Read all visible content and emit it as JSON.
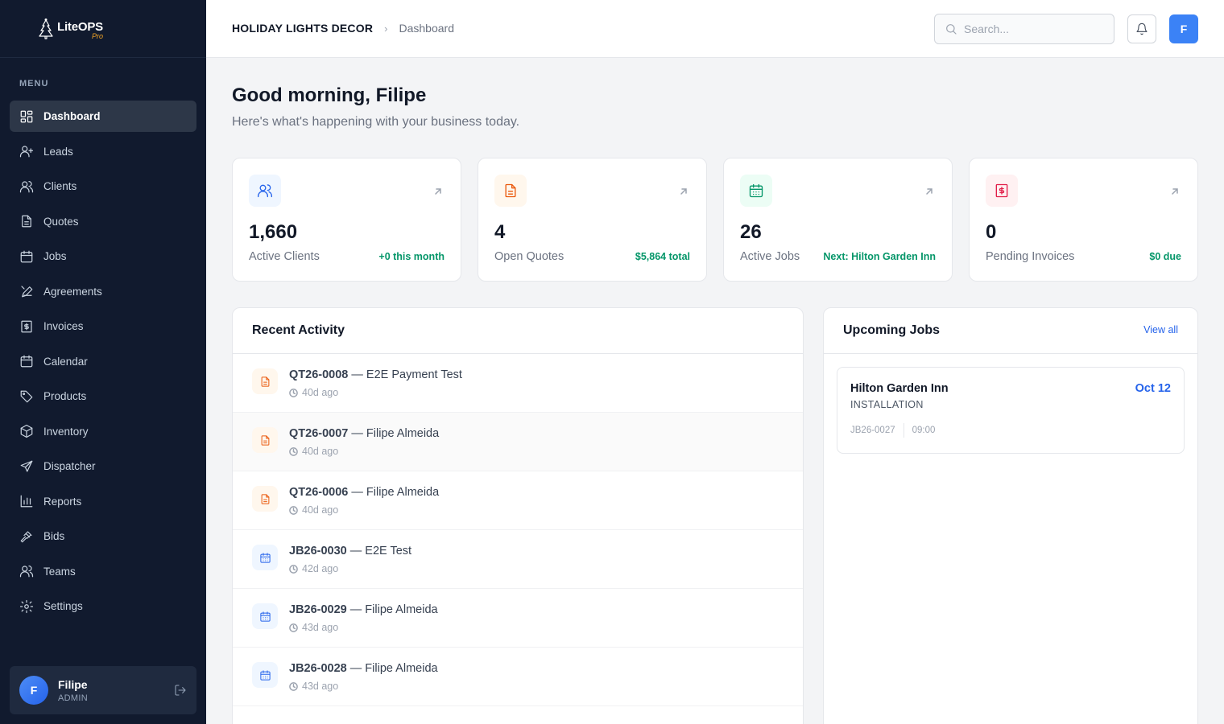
{
  "app": {
    "name": "LiteOPS",
    "edition": "Pro"
  },
  "sidebar": {
    "menu_label": "MENU",
    "items": [
      {
        "label": "Dashboard",
        "icon": "dashboard-icon"
      },
      {
        "label": "Leads",
        "icon": "user-plus-icon"
      },
      {
        "label": "Clients",
        "icon": "users-icon"
      },
      {
        "label": "Quotes",
        "icon": "document-icon"
      },
      {
        "label": "Jobs",
        "icon": "calendar-icon"
      },
      {
        "label": "Agreements",
        "icon": "signature-icon"
      },
      {
        "label": "Invoices",
        "icon": "dollar-document-icon"
      },
      {
        "label": "Calendar",
        "icon": "calendar-icon"
      },
      {
        "label": "Products",
        "icon": "tag-icon"
      },
      {
        "label": "Inventory",
        "icon": "box-icon"
      },
      {
        "label": "Dispatcher",
        "icon": "send-icon"
      },
      {
        "label": "Reports",
        "icon": "bar-chart-icon"
      },
      {
        "label": "Bids",
        "icon": "gavel-icon"
      },
      {
        "label": "Teams",
        "icon": "users-icon"
      },
      {
        "label": "Settings",
        "icon": "gear-icon"
      }
    ],
    "user": {
      "initial": "F",
      "name": "Filipe",
      "role": "ADMIN"
    }
  },
  "header": {
    "company": "HOLIDAY LIGHTS DECOR",
    "page": "Dashboard",
    "search_placeholder": "Search...",
    "avatar_initial": "F"
  },
  "main": {
    "greeting": "Good morning, Filipe",
    "subgreeting": "Here's what's happening with your business today.",
    "stats": [
      {
        "value": "1,660",
        "label": "Active Clients",
        "note": "+0 this month",
        "icon": "users-icon",
        "color": "#2563eb",
        "bg": "#eff6ff"
      },
      {
        "value": "4",
        "label": "Open Quotes",
        "note": "$5,864 total",
        "icon": "document-icon",
        "color": "#ea580c",
        "bg": "#fff7ed"
      },
      {
        "value": "26",
        "label": "Active Jobs",
        "note": "Next: Hilton Garden Inn",
        "icon": "calendar-icon",
        "color": "#059669",
        "bg": "#ecfdf5"
      },
      {
        "value": "0",
        "label": "Pending Invoices",
        "note": "$0 due",
        "icon": "dollar-document-icon",
        "color": "#e11d48",
        "bg": "#fff1f2"
      }
    ],
    "recent_activity": {
      "title": "Recent Activity",
      "items": [
        {
          "code": "QT26-0008",
          "text": " — E2E Payment Test",
          "time": "40d ago",
          "kind": "quote"
        },
        {
          "code": "QT26-0007",
          "text": " — Filipe Almeida",
          "time": "40d ago",
          "kind": "quote"
        },
        {
          "code": "QT26-0006",
          "text": " — Filipe Almeida",
          "time": "40d ago",
          "kind": "quote"
        },
        {
          "code": "JB26-0030",
          "text": " — E2E Test",
          "time": "42d ago",
          "kind": "job"
        },
        {
          "code": "JB26-0029",
          "text": " — Filipe Almeida",
          "time": "43d ago",
          "kind": "job"
        },
        {
          "code": "JB26-0028",
          "text": " — Filipe Almeida",
          "time": "43d ago",
          "kind": "job"
        }
      ]
    },
    "upcoming_jobs": {
      "title": "Upcoming Jobs",
      "view_all": "View all",
      "items": [
        {
          "name": "Hilton Garden Inn",
          "type": "INSTALLATION",
          "date": "Oct 12",
          "code": "JB26-0027",
          "time": "09:00"
        }
      ]
    }
  }
}
